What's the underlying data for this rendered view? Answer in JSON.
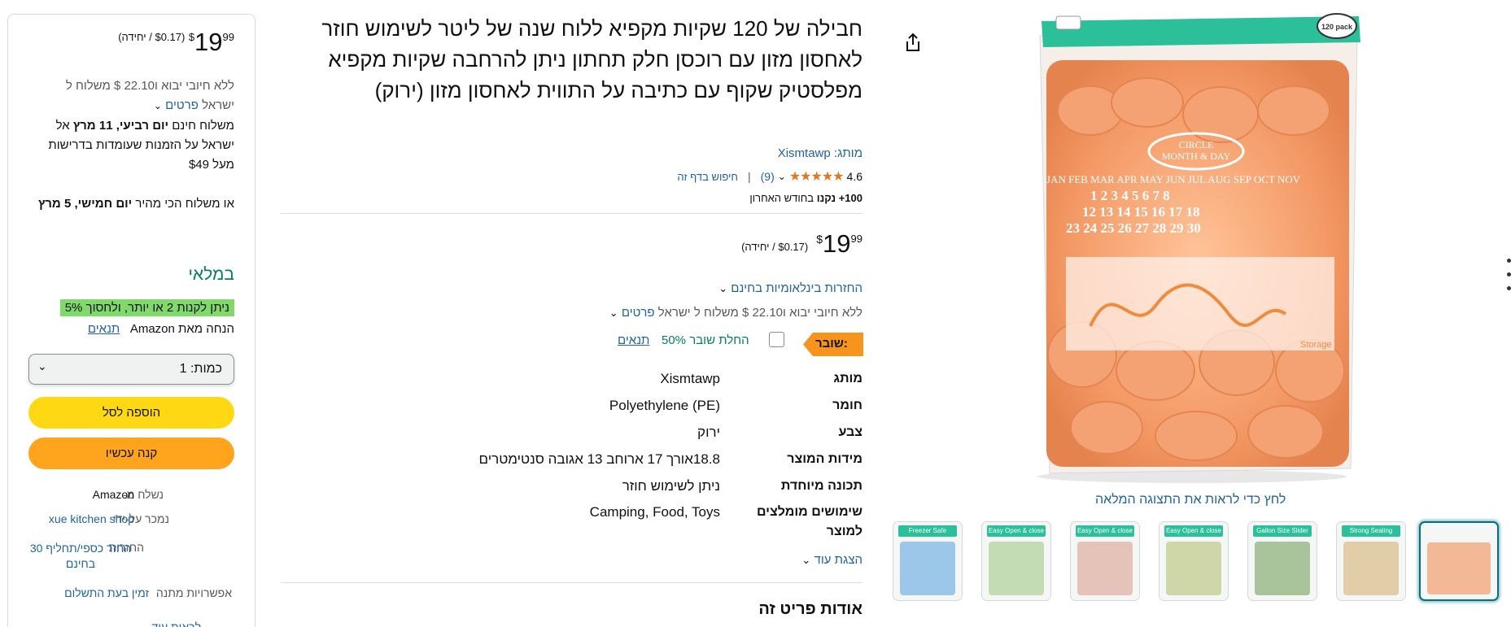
{
  "product": {
    "title": "חבילה של 120 שקיות מקפיא ללוח שנה של ליטר לשימוש חוזר לאחסון מזון עם רוכסן חלק תחתון ניתן להרחבה שקיות מקפיא מפלסטיק שקוף עם כתיבה על התווית לאחסון מזון (ירוק)",
    "brand_prefix": "מותג:",
    "brand_name": "Xismtawp",
    "rating": "4.6",
    "stars": "★★★★★",
    "review_count": "(9)",
    "separator": "|",
    "search_page": "חיפוש בדף זה",
    "bought_count": "100+",
    "bought_bold": "נקנו",
    "bought_rest": "בחודש האחרון",
    "price_symbol": "$",
    "price_whole": "19",
    "price_fraction": "99",
    "unit_price": "($0.17 / יחידה)",
    "returns_link": "החזרות בינלאומיות בחינם",
    "shipping_text": "ללא חיובי יבוא ו22.10 $ משלוח ל ישראל",
    "details_link": "פרטים",
    "coupon_badge": "שובר:",
    "coupon_text": "החלת שובר 50%",
    "coupon_terms": "תנאים",
    "specs": [
      {
        "label": "מותג",
        "value": "Xismtawp"
      },
      {
        "label": "חומר",
        "value": "Polyethylene (PE)"
      },
      {
        "label": "צבע",
        "value": "ירוק"
      },
      {
        "label": "מידות המוצר",
        "value": "18.8אורך 17 ארוחב 13 אגובה סנטימטרים"
      },
      {
        "label": "תכונה מיוחדת",
        "value": "ניתן לשימוש חוזר"
      },
      {
        "label": "שימושים מומלצים למוצר",
        "value": "Camping, Food, Toys"
      }
    ],
    "show_more": "הצגת עוד",
    "about_heading": "אודות פריט זה"
  },
  "gallery": {
    "full_view_link": "לחץ כדי לראות את התצוגה המלאה",
    "pack_badge": "120 pack",
    "bag_calendar_title": "CIRCLE MONTH & DAY",
    "bag_months": "JAN FEB MAR APR MAY JUN JUL AUG SEP OCT NOV",
    "bag_label": "Storage",
    "thumbnails": [
      {
        "label": "Freezer Safe"
      },
      {
        "label": "Easy Open & close"
      },
      {
        "label": "Easy Open & close"
      },
      {
        "label": "Easy Open & close"
      },
      {
        "label": "Gallon Size Slider Bag"
      },
      {
        "label": "Strong Sealing"
      },
      {
        "label": ""
      }
    ]
  },
  "buybox": {
    "price_symbol": "$",
    "price_whole": "19",
    "price_fraction": "99",
    "unit_price": "($0.17 / יחידה)",
    "shipping_line1": "ללא חיובי יבוא ו22.10 $ משלוח ל",
    "shipping_line2": "ישראל",
    "details_link": "פרטים",
    "free_delivery": "משלוח חינם",
    "delivery_date": "יום רביעי, 11 מרץ",
    "delivery_rest": "אל ישראל על הזמנות שעומדות בדרישות מעל $49",
    "fastest_prefix": "או משלוח הכי מהיר",
    "fastest_date": "יום חמישי, 5 מרץ",
    "in_stock": "במלאי",
    "promo": "ניתן לקנות 2 או יותר, ולחסוך 5%",
    "discount_text": "הנחה מאת Amazon",
    "discount_terms": "תנאים",
    "qty_label": "כמות:",
    "qty_value": "1",
    "add_to_cart": "הוספה לסל",
    "buy_now": "קנה עכשיו",
    "ships_from_label": "נשלח מ-",
    "ships_from_value": "Amazon",
    "sold_by_label": "נמכר על-ידי",
    "sold_by_value": "xue kitchen shop",
    "returns_label": "החזרות",
    "returns_value": "החזר כספי/תחליף 30 בחינם",
    "gift_label": "אפשרויות מתנה",
    "gift_value": "זמין בעת התשלום",
    "see_more": "לראות עוד"
  },
  "colors": {
    "link": "#2162a1",
    "cart_button": "#ffd814",
    "buy_button": "#ffa41c",
    "in_stock": "#067d62",
    "coupon_badge": "#f7941d",
    "promo_bg": "#7fda69",
    "selected_thumb": "#007185"
  }
}
